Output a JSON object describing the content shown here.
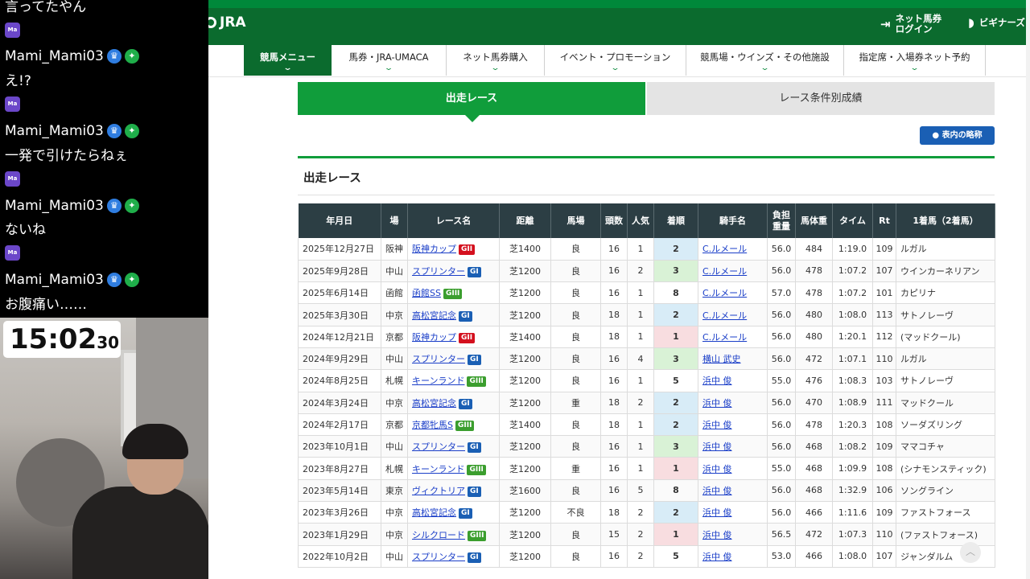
{
  "chat": {
    "top_text": "言ってたやん",
    "badge_text": "Ma",
    "messages": [
      {
        "user": "Mami_Mami03",
        "text": "え!?"
      },
      {
        "user": "Mami_Mami03",
        "text": "一発で引けたらねぇ"
      },
      {
        "user": "Mami_Mami03",
        "text": "ないね"
      },
      {
        "user": "Mami_Mami03",
        "text": "お腹痛い……"
      }
    ]
  },
  "timer": {
    "main": "15:02",
    "sub": "30"
  },
  "site": {
    "logo": "JRA",
    "login": "ネット馬券\nログイン",
    "beginners": "ビギナーズ"
  },
  "gnav": [
    {
      "label": "競馬メニュー",
      "active": true
    },
    {
      "label": "馬券・JRA-UMACA",
      "active": false
    },
    {
      "label": "ネット馬券購入",
      "active": false
    },
    {
      "label": "イベント・プロモーション",
      "active": false
    },
    {
      "label": "競馬場・ウインズ・その他施設",
      "active": false
    },
    {
      "label": "指定席・入場券ネット予約",
      "active": false
    }
  ],
  "tabs": {
    "active": "出走レース",
    "inactive": "レース条件別成績"
  },
  "legend_button": "表内の略称",
  "section_title": "出走レース",
  "table": {
    "headers": [
      "年月日",
      "場",
      "レース名",
      "距離",
      "馬場",
      "頭数",
      "人気",
      "着順",
      "騎手名",
      "負担\n重量",
      "馬体重",
      "タイム",
      "Rt",
      "1着馬（2着馬）"
    ],
    "rows": [
      {
        "date": "2025年12月27日",
        "venue": "阪神",
        "race": "阪神カップ",
        "grade": "GII",
        "gclass": "g2",
        "dist": "芝1400",
        "track": "良",
        "heads": "16",
        "pop": "1",
        "fin": "2",
        "jockey": "C.ルメール",
        "weight": "56.0",
        "bw": "484",
        "time": "1:19.0",
        "rt": "109",
        "winner": "ルガル"
      },
      {
        "date": "2025年9月28日",
        "venue": "中山",
        "race": "スプリンター",
        "grade": "GI",
        "gclass": "g1",
        "dist": "芝1200",
        "track": "良",
        "heads": "16",
        "pop": "2",
        "fin": "3",
        "jockey": "C.ルメール",
        "weight": "56.0",
        "bw": "478",
        "time": "1:07.2",
        "rt": "107",
        "winner": "ウインカーネリアン"
      },
      {
        "date": "2025年6月14日",
        "venue": "函館",
        "race": "函館SS",
        "grade": "GIII",
        "gclass": "g3",
        "dist": "芝1200",
        "track": "良",
        "heads": "16",
        "pop": "1",
        "fin": "8",
        "jockey": "C.ルメール",
        "weight": "57.0",
        "bw": "478",
        "time": "1:07.2",
        "rt": "101",
        "winner": "カピリナ"
      },
      {
        "date": "2025年3月30日",
        "venue": "中京",
        "race": "高松宮記念",
        "grade": "GI",
        "gclass": "g1",
        "dist": "芝1200",
        "track": "良",
        "heads": "18",
        "pop": "1",
        "fin": "2",
        "jockey": "C.ルメール",
        "weight": "56.0",
        "bw": "480",
        "time": "1:08.0",
        "rt": "113",
        "winner": "サトノレーヴ"
      },
      {
        "date": "2024年12月21日",
        "venue": "京都",
        "race": "阪神カップ",
        "grade": "GII",
        "gclass": "g2",
        "dist": "芝1400",
        "track": "良",
        "heads": "18",
        "pop": "1",
        "fin": "1",
        "jockey": "C.ルメール",
        "weight": "56.0",
        "bw": "480",
        "time": "1:20.1",
        "rt": "112",
        "winner": "(マッドクール)"
      },
      {
        "date": "2024年9月29日",
        "venue": "中山",
        "race": "スプリンター",
        "grade": "GI",
        "gclass": "g1",
        "dist": "芝1200",
        "track": "良",
        "heads": "16",
        "pop": "4",
        "fin": "3",
        "jockey": "横山 武史",
        "weight": "56.0",
        "bw": "472",
        "time": "1:07.1",
        "rt": "110",
        "winner": "ルガル"
      },
      {
        "date": "2024年8月25日",
        "venue": "札幌",
        "race": "キーンランド",
        "grade": "GIII",
        "gclass": "g3",
        "dist": "芝1200",
        "track": "良",
        "heads": "16",
        "pop": "1",
        "fin": "5",
        "jockey": "浜中 俊",
        "weight": "55.0",
        "bw": "476",
        "time": "1:08.3",
        "rt": "103",
        "winner": "サトノレーヴ"
      },
      {
        "date": "2024年3月24日",
        "venue": "中京",
        "race": "高松宮記念",
        "grade": "GI",
        "gclass": "g1",
        "dist": "芝1200",
        "track": "重",
        "heads": "18",
        "pop": "2",
        "fin": "2",
        "jockey": "浜中 俊",
        "weight": "56.0",
        "bw": "470",
        "time": "1:08.9",
        "rt": "111",
        "winner": "マッドクール"
      },
      {
        "date": "2024年2月17日",
        "venue": "京都",
        "race": "京都牝馬S",
        "grade": "GIII",
        "gclass": "g3",
        "dist": "芝1400",
        "track": "良",
        "heads": "18",
        "pop": "1",
        "fin": "2",
        "jockey": "浜中 俊",
        "weight": "56.0",
        "bw": "478",
        "time": "1:20.3",
        "rt": "108",
        "winner": "ソーダズリング"
      },
      {
        "date": "2023年10月1日",
        "venue": "中山",
        "race": "スプリンター",
        "grade": "GI",
        "gclass": "g1",
        "dist": "芝1200",
        "track": "良",
        "heads": "16",
        "pop": "1",
        "fin": "3",
        "jockey": "浜中 俊",
        "weight": "56.0",
        "bw": "468",
        "time": "1:08.2",
        "rt": "109",
        "winner": "ママコチャ"
      },
      {
        "date": "2023年8月27日",
        "venue": "札幌",
        "race": "キーンランド",
        "grade": "GIII",
        "gclass": "g3",
        "dist": "芝1200",
        "track": "重",
        "heads": "16",
        "pop": "1",
        "fin": "1",
        "jockey": "浜中 俊",
        "weight": "55.0",
        "bw": "468",
        "time": "1:09.9",
        "rt": "108",
        "winner": "(シナモンスティック)"
      },
      {
        "date": "2023年5月14日",
        "venue": "東京",
        "race": "ヴィクトリア",
        "grade": "GI",
        "gclass": "g1",
        "dist": "芝1600",
        "track": "良",
        "heads": "16",
        "pop": "5",
        "fin": "8",
        "jockey": "浜中 俊",
        "weight": "56.0",
        "bw": "468",
        "time": "1:32.9",
        "rt": "106",
        "winner": "ソングライン"
      },
      {
        "date": "2023年3月26日",
        "venue": "中京",
        "race": "高松宮記念",
        "grade": "GI",
        "gclass": "g1",
        "dist": "芝1200",
        "track": "不良",
        "heads": "18",
        "pop": "2",
        "fin": "2",
        "jockey": "浜中 俊",
        "weight": "56.0",
        "bw": "466",
        "time": "1:11.6",
        "rt": "109",
        "winner": "ファストフォース"
      },
      {
        "date": "2023年1月29日",
        "venue": "中京",
        "race": "シルクロード",
        "grade": "GIII",
        "gclass": "g3",
        "dist": "芝1200",
        "track": "良",
        "heads": "15",
        "pop": "2",
        "fin": "1",
        "jockey": "浜中 俊",
        "weight": "56.5",
        "bw": "472",
        "time": "1:07.3",
        "rt": "110",
        "winner": "(ファストフォース)"
      },
      {
        "date": "2022年10月2日",
        "venue": "中山",
        "race": "スプリンター",
        "grade": "GI",
        "gclass": "g1",
        "dist": "芝1200",
        "track": "良",
        "heads": "16",
        "pop": "2",
        "fin": "5",
        "jockey": "浜中 俊",
        "weight": "53.0",
        "bw": "466",
        "time": "1:08.0",
        "rt": "107",
        "winner": "ジャンダルム"
      }
    ]
  },
  "colors": {
    "jra_green": "#0b6b2e",
    "tab_green": "#109d3b",
    "header_dark": "#2c3e44",
    "link_blue": "#1a3ec8"
  }
}
